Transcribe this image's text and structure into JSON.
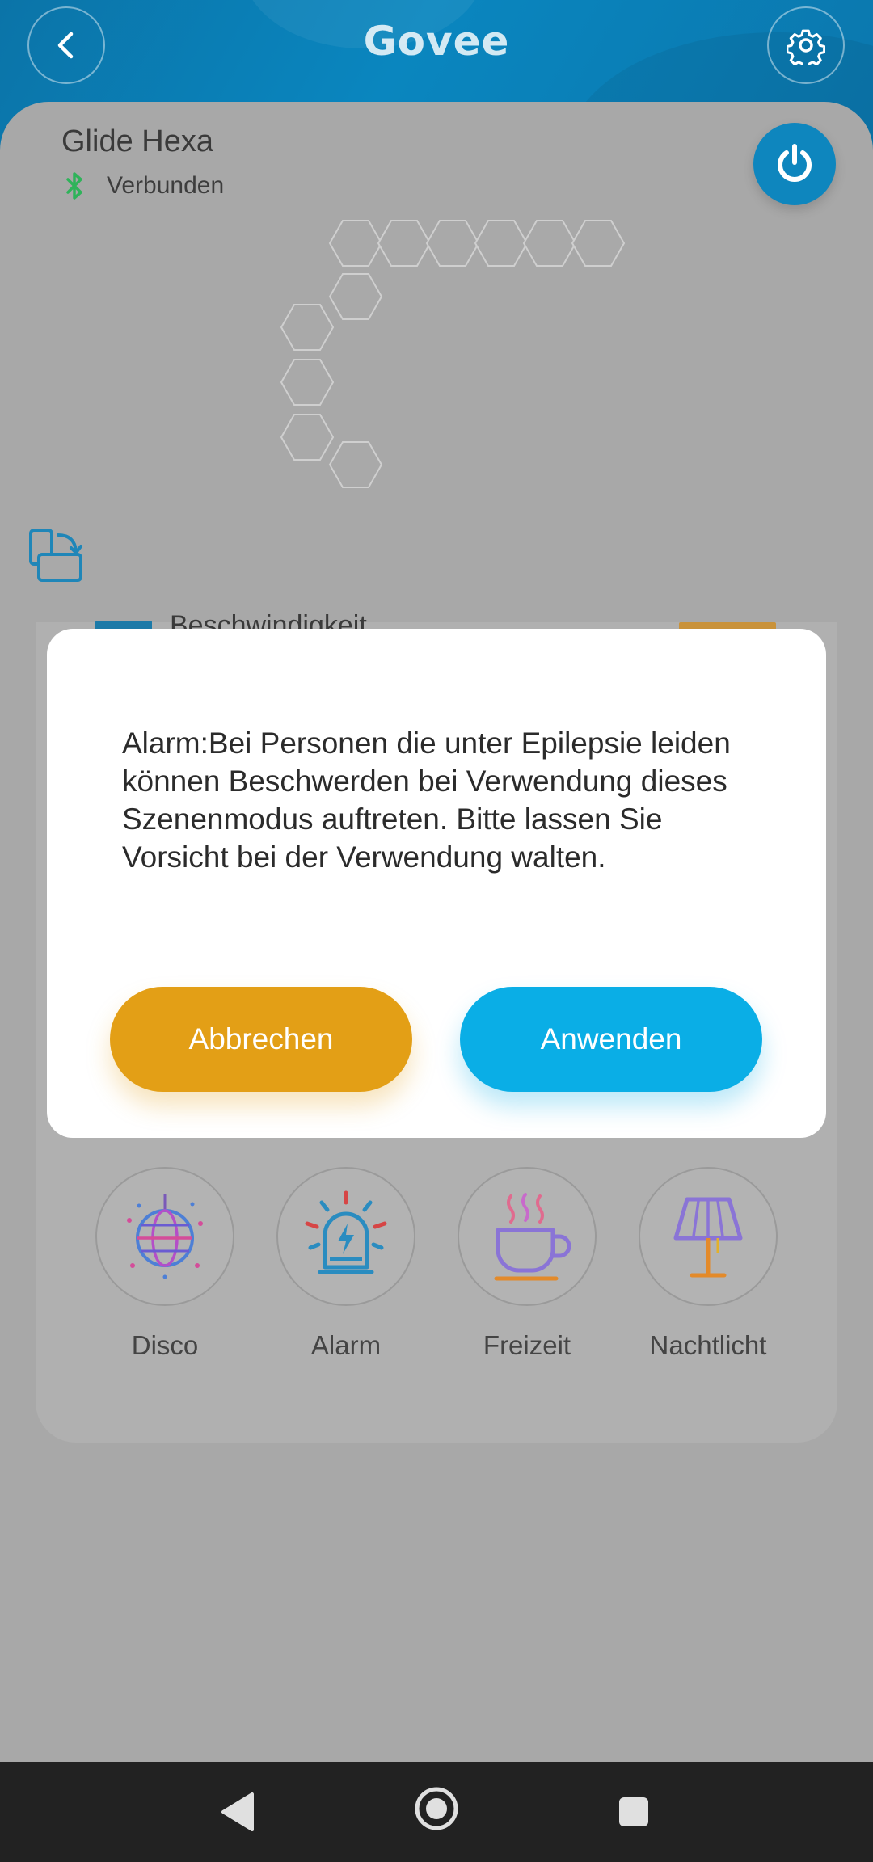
{
  "header": {
    "logo_text": "Govee",
    "back_icon": "chevron-left-icon",
    "settings_icon": "gear-icon"
  },
  "device": {
    "name": "Glide Hexa",
    "connection_status": "Verbunden",
    "connection_icon": "bluetooth-icon",
    "power_icon": "power-icon"
  },
  "background_peek": {
    "text": "Beschwindigkeit"
  },
  "dialog": {
    "message": "Alarm:Bei Personen die unter Epilepsie leiden können Beschwerden bei Verwendung dieses Szenenmodus auftreten. Bitte lassen Sie Vorsicht bei der Verwendung walten.",
    "cancel_label": "Abbrechen",
    "apply_label": "Anwenden",
    "cancel_color": "#e39f16",
    "apply_color": "#0aaee6"
  },
  "scenes": [
    {
      "label": "Disco",
      "icon": "disco-ball-icon"
    },
    {
      "label": "Alarm",
      "icon": "alarm-siren-icon"
    },
    {
      "label": "Freizeit",
      "icon": "coffee-cup-icon"
    },
    {
      "label": "Nachtlicht",
      "icon": "lamp-icon"
    }
  ],
  "colors": {
    "accent_blue": "#0a86bf",
    "connected_green": "#2fb35a",
    "overlay_gray": "#a8a8a8"
  }
}
